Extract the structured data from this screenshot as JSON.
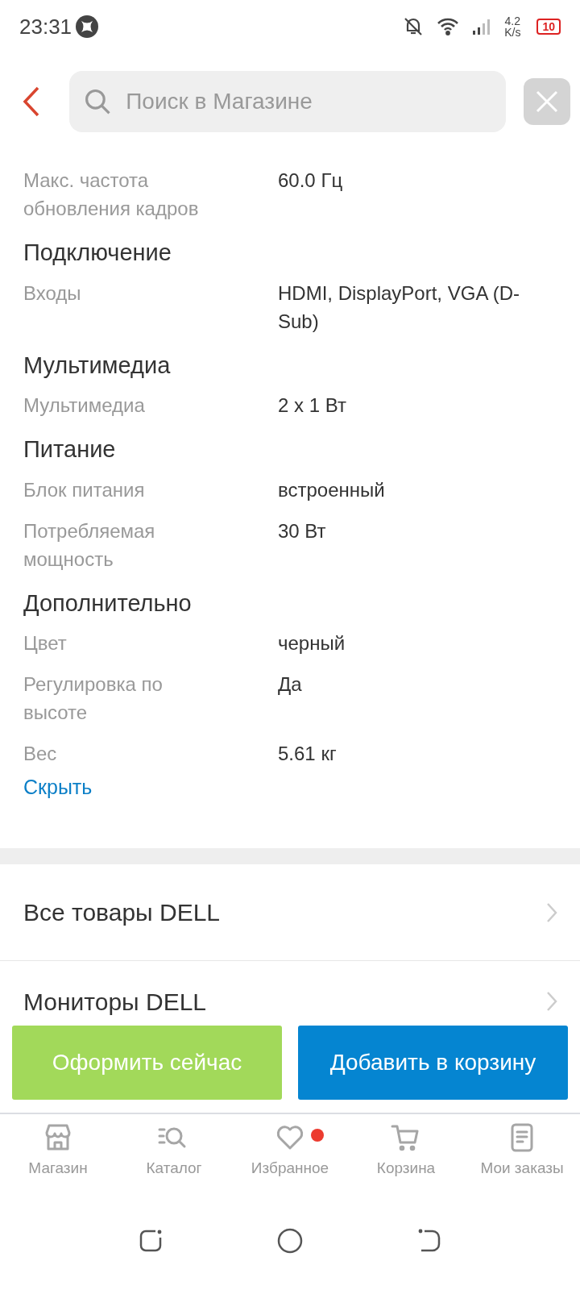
{
  "status_bar": {
    "time": "23:31",
    "speed_value": "4.2",
    "speed_unit": "K/s",
    "battery": "10"
  },
  "search": {
    "placeholder": "Поиск в Магазине"
  },
  "specs": [
    {
      "rows": [
        {
          "label": "Макс. частота обновления кадров",
          "value": "60.0 Гц"
        }
      ]
    },
    {
      "section": "Подключение",
      "rows": [
        {
          "label": "Входы",
          "value": "HDMI, DisplayPort, VGA (D-Sub)"
        }
      ]
    },
    {
      "section": "Мультимедиа",
      "rows": [
        {
          "label": "Мультимедиа",
          "value": "2 x 1 Вт"
        }
      ]
    },
    {
      "section": "Питание",
      "rows": [
        {
          "label": "Блок питания",
          "value": "встроенный"
        },
        {
          "label": "Потребляемая мощность",
          "value": "30 Вт"
        }
      ]
    },
    {
      "section": "Дополнительно",
      "rows": [
        {
          "label": "Цвет",
          "value": "черный"
        },
        {
          "label": "Регулировка по высоте",
          "value": "Да"
        },
        {
          "label": "Вес",
          "value": "5.61 кг"
        }
      ]
    }
  ],
  "hide_link": "Скрыть",
  "links": [
    "Все товары DELL",
    "Мониторы DELL"
  ],
  "buttons": [
    {
      "label": "Оформить сейчас",
      "kind": "buy"
    },
    {
      "label": "Добавить в корзину",
      "kind": "cart"
    }
  ],
  "bottom_nav": [
    {
      "label": "Магазин",
      "kind": "store",
      "badge": false
    },
    {
      "label": "Каталог",
      "kind": "catalog",
      "badge": false
    },
    {
      "label": "Избранное",
      "kind": "heart",
      "badge": true
    },
    {
      "label": "Корзина",
      "kind": "cart",
      "badge": false
    },
    {
      "label": "Мои заказы",
      "kind": "orders",
      "badge": false
    }
  ]
}
